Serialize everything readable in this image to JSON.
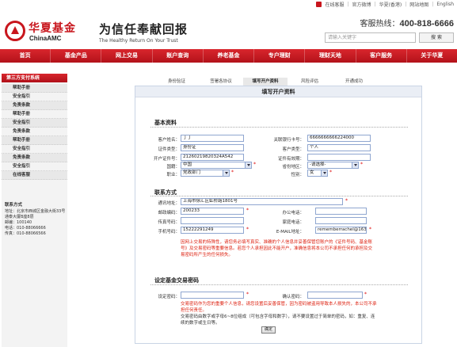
{
  "top_links": {
    "online_service": "在线客服",
    "weibo": "官方微博",
    "hk": "华夏(香港)",
    "sitemap": "网站地图",
    "english": "English"
  },
  "brand": {
    "name_cn": "华夏基金",
    "name_en": "ChinaAMC",
    "slogan_cn": "为信任奉献回报",
    "slogan_en": "The Healthy Return On Your Trust"
  },
  "hotline": {
    "label": "客服热线：",
    "number": "400-818-6666"
  },
  "search": {
    "placeholder": "请输入关键字",
    "button": "搜 索"
  },
  "nav": [
    "首页",
    "基金产品",
    "网上交易",
    "账户查询",
    "养老基金",
    "专户理财",
    "理财天地",
    "客户服务",
    "关于华夏"
  ],
  "sidebar": {
    "title": "第三方支付系统",
    "items": [
      "帮助手册",
      "安全指引",
      "免责条款",
      "帮助手册",
      "安全指引",
      "免责条款",
      "帮助手册",
      "安全指引",
      "免责条款",
      "安全指引",
      "在线客服"
    ],
    "contact": {
      "title": "联系方式",
      "address": "地址：北京市西城区金融大街33号通泰大厦B座8层",
      "postcode": "邮编：100140",
      "phone": "电话：010-88066666",
      "fax": "传真：010-88066566"
    }
  },
  "steps": [
    "身份验证",
    "签署各协议",
    "填写开户资料",
    "风险评估",
    "开通成功"
  ],
  "form": {
    "title": "填写开户资料",
    "basic_title": "基本资料",
    "fields": {
      "name_label": "客户姓名：",
      "name": "丁丁",
      "bank_account_label": "关联银行卡号：",
      "bank_account": "6666666666224000",
      "id_type_label": "证件类型：",
      "id_type": "身份证",
      "client_type_label": "客户类型：",
      "client_type": "个人",
      "id_number_label": "开户证件号：",
      "id_number": "21260219820324A542",
      "id_expiry_label": "证件有效期：",
      "id_expiry": "",
      "country_label": "国籍：",
      "country": "中国",
      "province_label": "省份地区：",
      "province": "-请选择-",
      "job_label": "职业：",
      "job": "党政部门",
      "gender_label": "性别：",
      "gender": "女"
    },
    "contact_title": "联系方式",
    "contact": {
      "address_label": "通讯地址：",
      "address": "上海市徐汇区虹桥路1801号",
      "postcode_label": "邮政编码：",
      "postcode": "200233",
      "office_phone_label": "办公电话：",
      "office_phone": "",
      "fax_label": "传真号码：",
      "fax": "",
      "home_phone_label": "家庭电话：",
      "home_phone": "",
      "mobile_label": "手机号码：",
      "mobile": "15222291249",
      "email_label": "E-MAIL地址：",
      "email": "rememberrachel@163"
    },
    "notice_red": "因网上交易的特殊性，请您务必填写真实、准确的个人信息并妥善保管您账户的《证件号码、基金账号》及交易密码等重要信息。若您个人承担因此不能开户，准确信息将本公司不承担任何的承担及交易密码所产生的任何损失。",
    "password_title": "设定基金交易密码",
    "password": {
      "set_label": "设定密码：",
      "confirm_label": "确认密码："
    },
    "notice_pw_red": "交易密码作为您的重要个人信息，请您设置后妥善保管，因为密码被盗用导致本人损失的，本公司不承担任何责任。",
    "notice_pw_black": "交易密码由数字或字母6~8位组成（可包含字母和数字），请不要设置过于简单的密码，如：重复、连续的数字或生日等。",
    "submit": "确定"
  },
  "colors": {
    "brand_red": "#c8161d",
    "field_border": "#8fa6d0",
    "notice_red": "#d21"
  }
}
